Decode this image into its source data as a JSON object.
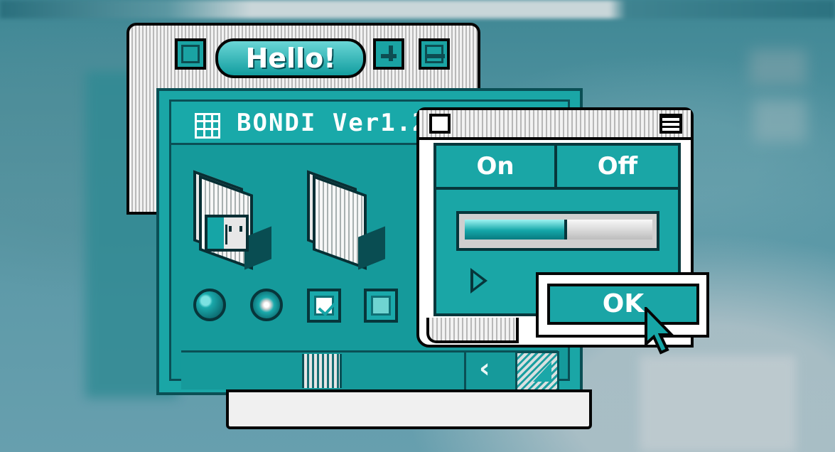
{
  "hello_window": {
    "title": "Hello!"
  },
  "main_window": {
    "title": "BONDI Ver1.2"
  },
  "settings_window": {
    "toggle_on": "On",
    "toggle_off": "Off",
    "slider_level": 0.53
  },
  "dialog": {
    "ok_label": "OK"
  },
  "icons": {
    "grid": "grid-icon",
    "finder_folder": "finder-folder-icon",
    "folder": "folder-icon",
    "cursor": "cursor-icon"
  },
  "colors": {
    "accent": "#1aa6a6",
    "dark": "#07363b",
    "light": "#f2f2f2"
  }
}
